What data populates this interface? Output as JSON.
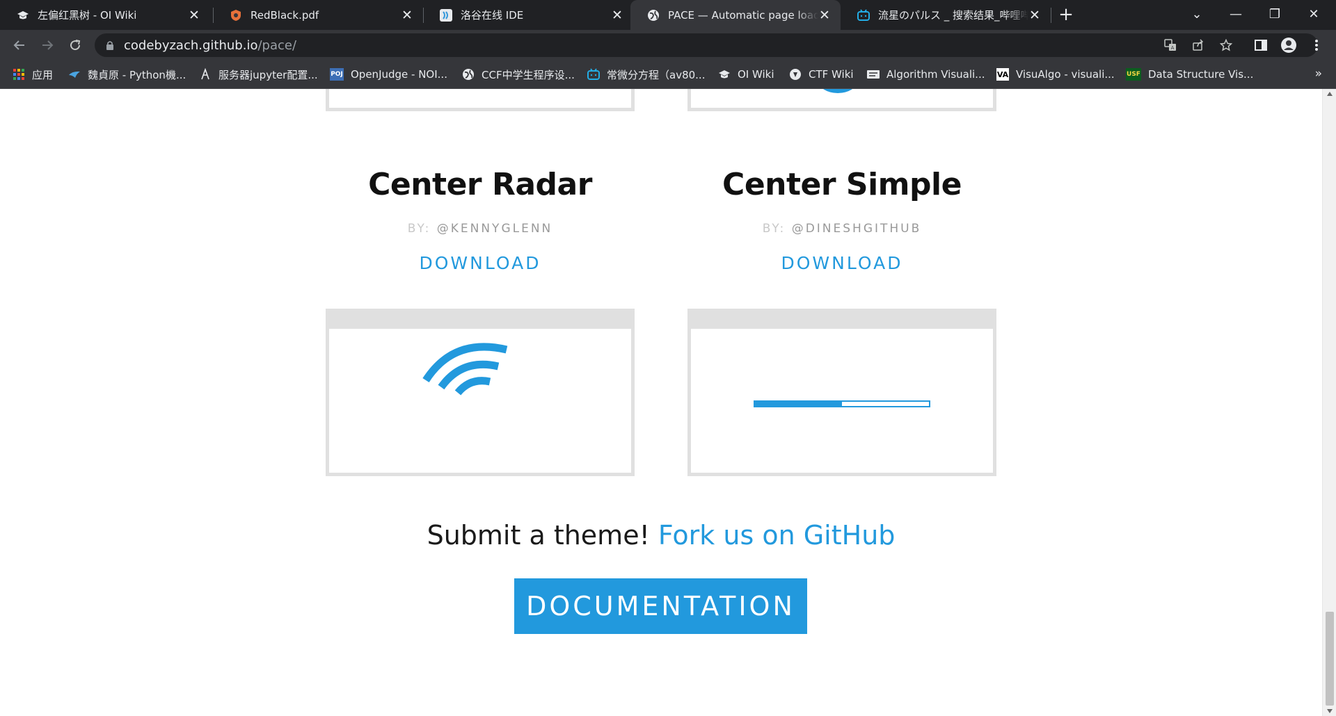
{
  "tabs": [
    {
      "title": "左偏红黑树 - OI Wiki",
      "icon": "oi-wiki-icon"
    },
    {
      "title": "RedBlack.pdf",
      "icon": "pdf-shield-icon"
    },
    {
      "title": "洛谷在线 IDE",
      "icon": "luogu-icon"
    },
    {
      "title": "PACE — Automatic page load p",
      "icon": "globe-icon"
    },
    {
      "title": "流星のパルス _ 搜索结果_哔哩哔",
      "icon": "bilibili-icon"
    }
  ],
  "tab_close": "✕",
  "new_tab": "+",
  "window_controls": {
    "minimize": "—",
    "restore": "❐",
    "close": "✕",
    "dropdown": "⌄"
  },
  "address": {
    "host": "codebyzach.github.io",
    "path": "/pace/"
  },
  "bookmarks": [
    {
      "label": "应用",
      "icon": "apps-grid-icon"
    },
    {
      "label": "魏貞原 - Python機...",
      "icon": "bird-icon"
    },
    {
      "label": "服务器jupyter配置...",
      "icon": "jupyter-icon"
    },
    {
      "label": "OpenJudge - NOI...",
      "icon": "poj-icon"
    },
    {
      "label": "CCF中学生程序设...",
      "icon": "globe-icon"
    },
    {
      "label": "常微分方程（av80...",
      "icon": "bilibili-icon"
    },
    {
      "label": "OI Wiki",
      "icon": "oi-wiki-icon"
    },
    {
      "label": "CTF Wiki",
      "icon": "ctf-icon"
    },
    {
      "label": "Algorithm Visuali...",
      "icon": "algo-icon"
    },
    {
      "label": "VisuAlgo - visuali...",
      "icon": "visualgo-icon"
    },
    {
      "label": "Data Structure Vis...",
      "icon": "usf-icon"
    }
  ],
  "bookmarks_more": "»",
  "themes": [
    {
      "name": "Center Radar",
      "by_prefix": "BY:",
      "author": "@KENNYGLENN",
      "download": "DOWNLOAD"
    },
    {
      "name": "Center Simple",
      "by_prefix": "BY:",
      "author": "@DINESHGITHUB",
      "download": "DOWNLOAD"
    }
  ],
  "progress_value": 0.5,
  "submit": {
    "text": "Submit a theme! ",
    "link": "Fork us on GitHub"
  },
  "documentation": "DOCUMENTATION",
  "colors": {
    "accent": "#2299dd",
    "chrome_dark": "#202124",
    "chrome_tab": "#35363a",
    "frame": "#e0e0e0"
  }
}
